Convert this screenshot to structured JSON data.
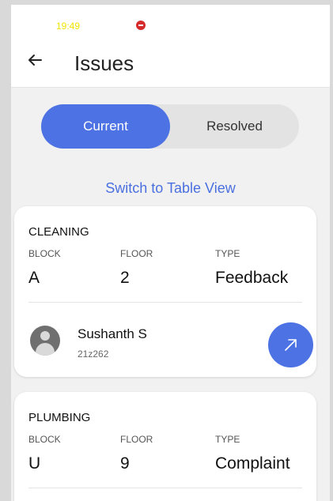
{
  "status_bar": {
    "time": "19:49"
  },
  "header": {
    "title": "Issues"
  },
  "tabs": {
    "current": "Current",
    "resolved": "Resolved"
  },
  "switch_view": "Switch to Table View",
  "issues": [
    {
      "category": "CLEANING",
      "block_label": "BLOCK",
      "block": "A",
      "floor_label": "FLOOR",
      "floor": "2",
      "type_label": "TYPE",
      "type": "Feedback",
      "user_name": "Sushanth S",
      "user_id": "21z262"
    },
    {
      "category": "PLUMBING",
      "block_label": "BLOCK",
      "block": "U",
      "floor_label": "FLOOR",
      "floor": "9",
      "type_label": "TYPE",
      "type": "Complaint"
    }
  ],
  "colors": {
    "accent": "#4c72e4",
    "link": "#4a70e0",
    "status_time": "#f0e400"
  }
}
